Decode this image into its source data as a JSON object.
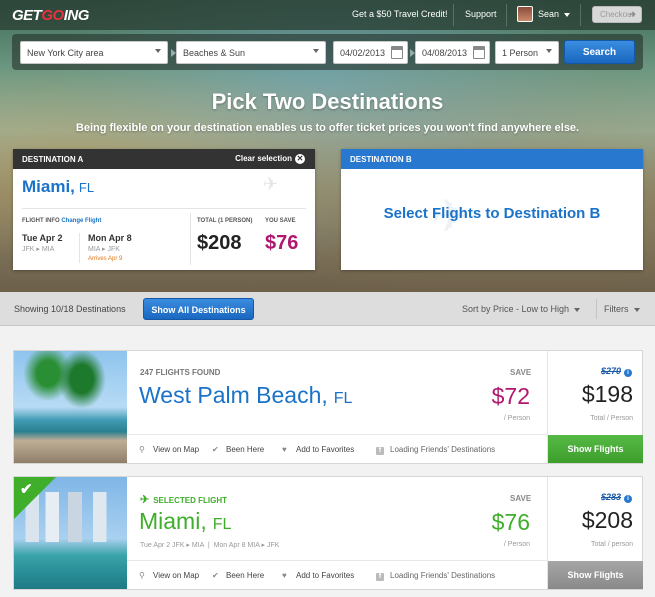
{
  "header": {
    "logo": {
      "part1": "GET",
      "part2": "GO",
      "part3": "ING"
    },
    "travel_credit": "Get a $50 Travel Credit!",
    "support": "Support",
    "user_name": "Sean",
    "checkout": "Checkout"
  },
  "search": {
    "origin": "New York City area",
    "destination": "Beaches & Sun",
    "depart_date": "04/02/2013",
    "return_date": "04/08/2013",
    "passengers": "1 Person",
    "search_button": "Search"
  },
  "hero": {
    "title": "Pick Two Destinations",
    "subtitle": "Being flexible on your destination enables us to offer ticket prices you won't find anywhere else."
  },
  "destination_a": {
    "header": "DESTINATION A",
    "clear": "Clear selection",
    "city": "Miami,",
    "state": "FL",
    "flight_info_label": "FLIGHT INFO",
    "change_flight": "Change Flight",
    "depart_day": "Tue Apr 2",
    "depart_route": "JFK ▸ MIA",
    "return_day": "Mon Apr 8",
    "return_route": "MIA ▸ JFK",
    "arrives": "Arrives Apr 9",
    "total_label": "TOTAL (1 PERSON)",
    "total": "$208",
    "save_label": "YOU SAVE",
    "save": "$76"
  },
  "destination_b": {
    "header": "DESTINATION B",
    "message": "Select Flights to Destination B"
  },
  "filter_bar": {
    "showing": "Showing 10/18 Destinations",
    "show_all": "Show All Destinations",
    "sort": "Sort by Price - Low to High",
    "filters": "Filters"
  },
  "results": [
    {
      "flights_found": "247 FLIGHTS FOUND",
      "city": "West Palm Beach,",
      "state": "FL",
      "save_label": "SAVE",
      "save": "$72",
      "per_person": "/ Person",
      "old_price": "$270",
      "price": "$198",
      "total_per": "Total / Person",
      "view_on_map": "View on Map",
      "been_here": "Been Here",
      "add_favorites": "Add to Favorites",
      "friends": "Loading Friends' Destinations",
      "show_flights": "Show Flights",
      "save_color": "#b0176f"
    },
    {
      "selected_label": "SELECTED FLIGHT",
      "city": "Miami,",
      "state": "FL",
      "depart": "Tue Apr 2",
      "depart_route": "JFK ▸ MIA",
      "return": "Mon Apr 8",
      "return_route": "MIA ▸ JFK",
      "save_label": "SAVE",
      "save": "$76",
      "per_person": "/ Person",
      "old_price": "$283",
      "price": "$208",
      "total_per": "Total / person",
      "view_on_map": "View on Map",
      "been_here": "Been Here",
      "add_favorites": "Add to Favorites",
      "friends": "Loading Friends' Destinations",
      "show_flights": "Show Flights",
      "save_color": "#3fae2a"
    }
  ],
  "colors": {
    "accent_blue": "#1a73c8",
    "brand_red": "#e8333e",
    "save_pink": "#b0176f",
    "selected_green": "#3fae2a"
  }
}
